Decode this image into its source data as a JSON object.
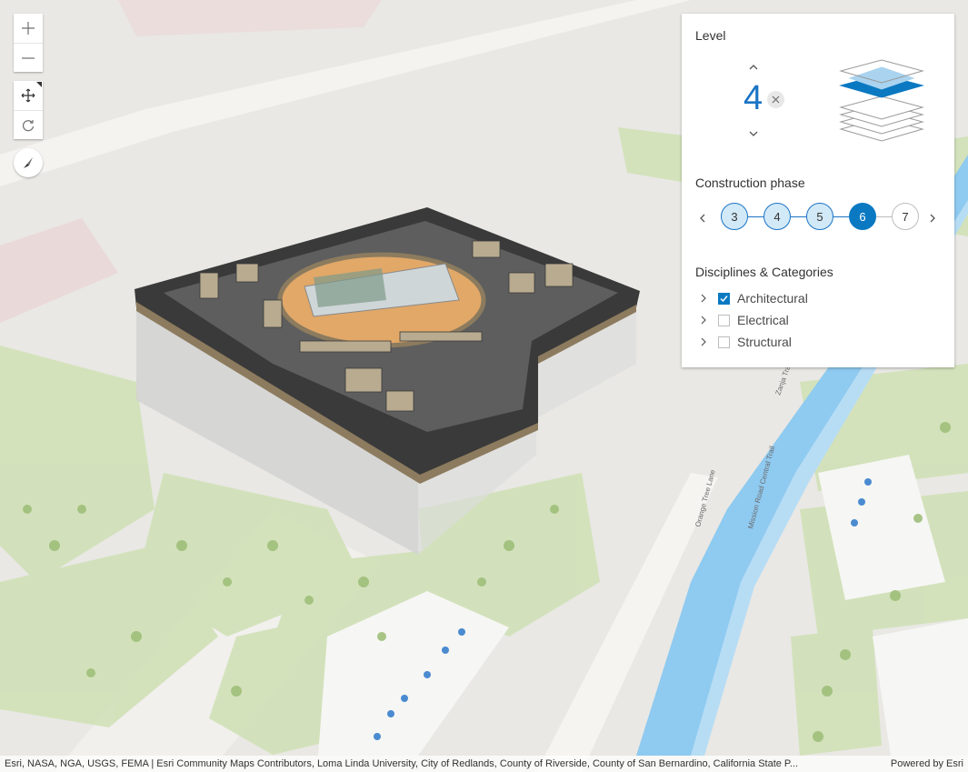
{
  "map": {
    "street_labels": [
      "Orange Tree Lane",
      "Mission Road Central Trail",
      "Zanja Trail"
    ]
  },
  "navigation": {
    "zoom_in_icon": "plus-icon",
    "zoom_out_icon": "minus-icon",
    "pan_icon": "move-arrows-icon",
    "rotate_icon": "rotate-icon",
    "compass_icon": "compass-icon"
  },
  "panel": {
    "level": {
      "title": "Level",
      "value": "4",
      "up_icon": "chevron-up-icon",
      "down_icon": "chevron-down-icon",
      "clear_icon": "close-icon",
      "total_levels": 6,
      "selected_level_index": 4
    },
    "phase": {
      "title": "Construction phase",
      "steps": [
        {
          "label": "3",
          "state": "done"
        },
        {
          "label": "4",
          "state": "done"
        },
        {
          "label": "5",
          "state": "done"
        },
        {
          "label": "6",
          "state": "active"
        },
        {
          "label": "7",
          "state": "todo"
        }
      ]
    },
    "disciplines": {
      "title": "Disciplines & Categories",
      "items": [
        {
          "label": "Architectural",
          "checked": true
        },
        {
          "label": "Electrical",
          "checked": false
        },
        {
          "label": "Structural",
          "checked": false
        }
      ]
    }
  },
  "attribution": {
    "text": "Esri, NASA, NGA, USGS, FEMA | Esri Community Maps Contributors, Loma Linda University, City of Redlands, County of Riverside, County of San Bernardino, California State P...",
    "powered": "Powered by Esri"
  },
  "colors": {
    "accent": "#0a79c2",
    "accent_light": "#d2e9f7",
    "water": "#8fcaf0",
    "park": "#cde0b0",
    "map_bg": "#e9e8e4"
  }
}
